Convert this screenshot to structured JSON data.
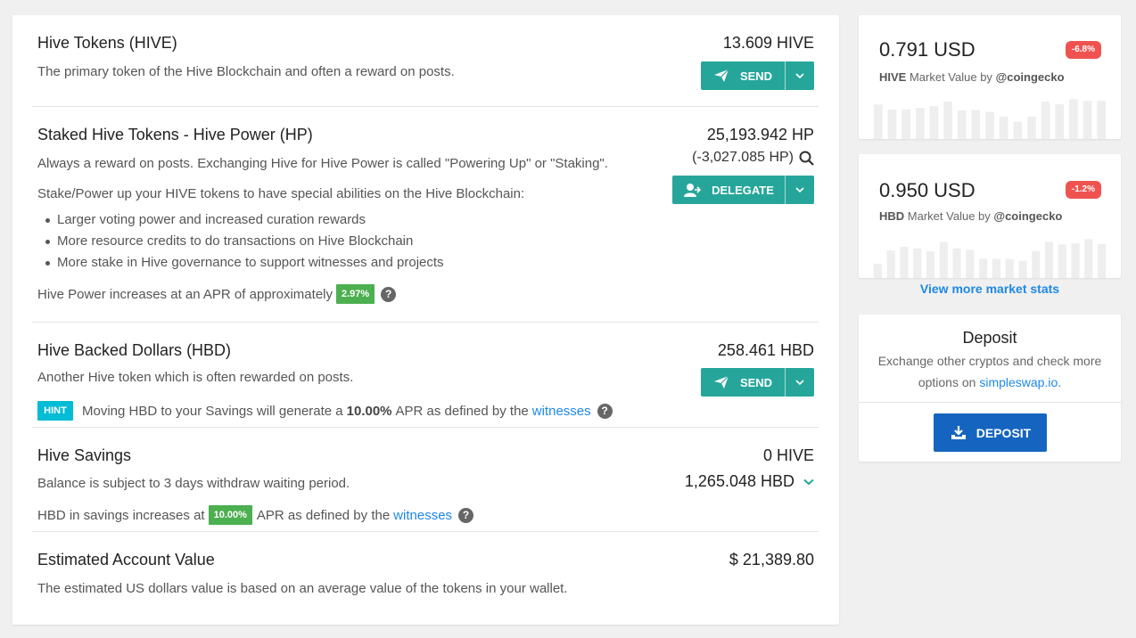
{
  "hive": {
    "title": "Hive Tokens (HIVE)",
    "desc": "The primary token of the Hive Blockchain and often a reward on posts.",
    "amount": "13.609 HIVE",
    "button": "SEND"
  },
  "hp": {
    "title": "Staked Hive Tokens - Hive Power (HP)",
    "desc": "Always a reward on posts. Exchanging Hive for Hive Power is called \"Powering Up\" or \"Staking\".",
    "desc2": "Stake/Power up your HIVE tokens to have special abilities on the Hive Blockchain:",
    "bullets": [
      "Larger voting power and increased curation rewards",
      "More resource credits to do transactions on Hive Blockchain",
      "More stake in Hive governance to support witnesses and projects"
    ],
    "apr_text": "Hive Power increases at an APR of approximately",
    "apr": "2.97%",
    "amount": "25,193.942 HP",
    "delegated": "(-3,027.085 HP)",
    "button": "DELEGATE"
  },
  "hbd": {
    "title": "Hive Backed Dollars (HBD)",
    "desc": "Another Hive token which is often rewarded on posts.",
    "amount": "258.461 HBD",
    "button": "SEND",
    "hint_badge": "HINT",
    "hint_pre": "Moving HBD to your Savings will generate a",
    "hint_rate": "10.00%",
    "hint_mid": "APR as defined by the",
    "hint_link": "witnesses"
  },
  "savings": {
    "title": "Hive Savings",
    "desc": "Balance is subject to 3 days withdraw waiting period.",
    "amount_hive": "0 HIVE",
    "amount_hbd": "1,265.048 HBD",
    "apr_pre": "HBD in savings increases at",
    "apr": "10.00%",
    "apr_mid": "APR as defined by the",
    "apr_link": "witnesses"
  },
  "estimate": {
    "title": "Estimated Account Value",
    "desc": "The estimated US dollars value is based on an average value of the tokens in your wallet.",
    "amount": "$ 21,389.80"
  },
  "market": {
    "hive": {
      "price": "0.791 USD",
      "change": "-6.8%",
      "label_token": "HIVE",
      "label_mid": "Market Value by",
      "label_source": "@coingecko",
      "bars": [
        0.84,
        0.72,
        0.72,
        0.76,
        0.8,
        0.91,
        0.7,
        0.71,
        0.66,
        0.54,
        0.42,
        0.55,
        0.91,
        0.85,
        0.97,
        0.93,
        0.93
      ]
    },
    "hbd": {
      "price": "0.950 USD",
      "change": "-1.2%",
      "label_token": "HBD",
      "label_mid": "Market Value by",
      "label_source": "@coingecko",
      "bars": [
        0.35,
        0.67,
        0.76,
        0.72,
        0.65,
        0.88,
        0.72,
        0.69,
        0.47,
        0.47,
        0.46,
        0.42,
        0.66,
        0.88,
        0.82,
        0.85,
        0.95,
        0.83
      ]
    },
    "view_more": "View more market stats"
  },
  "deposit": {
    "title": "Deposit",
    "desc_pre": "Exchange other cryptos and check more options on",
    "desc_link": "simpleswap.io",
    "desc_post": ".",
    "button": "DEPOSIT"
  },
  "colors": {
    "accent": "#26a69a",
    "link": "#1e88e5",
    "badge_green": "#4caf50",
    "hint": "#00bcd4",
    "negative": "#ef5350",
    "deposit": "#1565c0",
    "spark_bar": "#eeeeee"
  }
}
